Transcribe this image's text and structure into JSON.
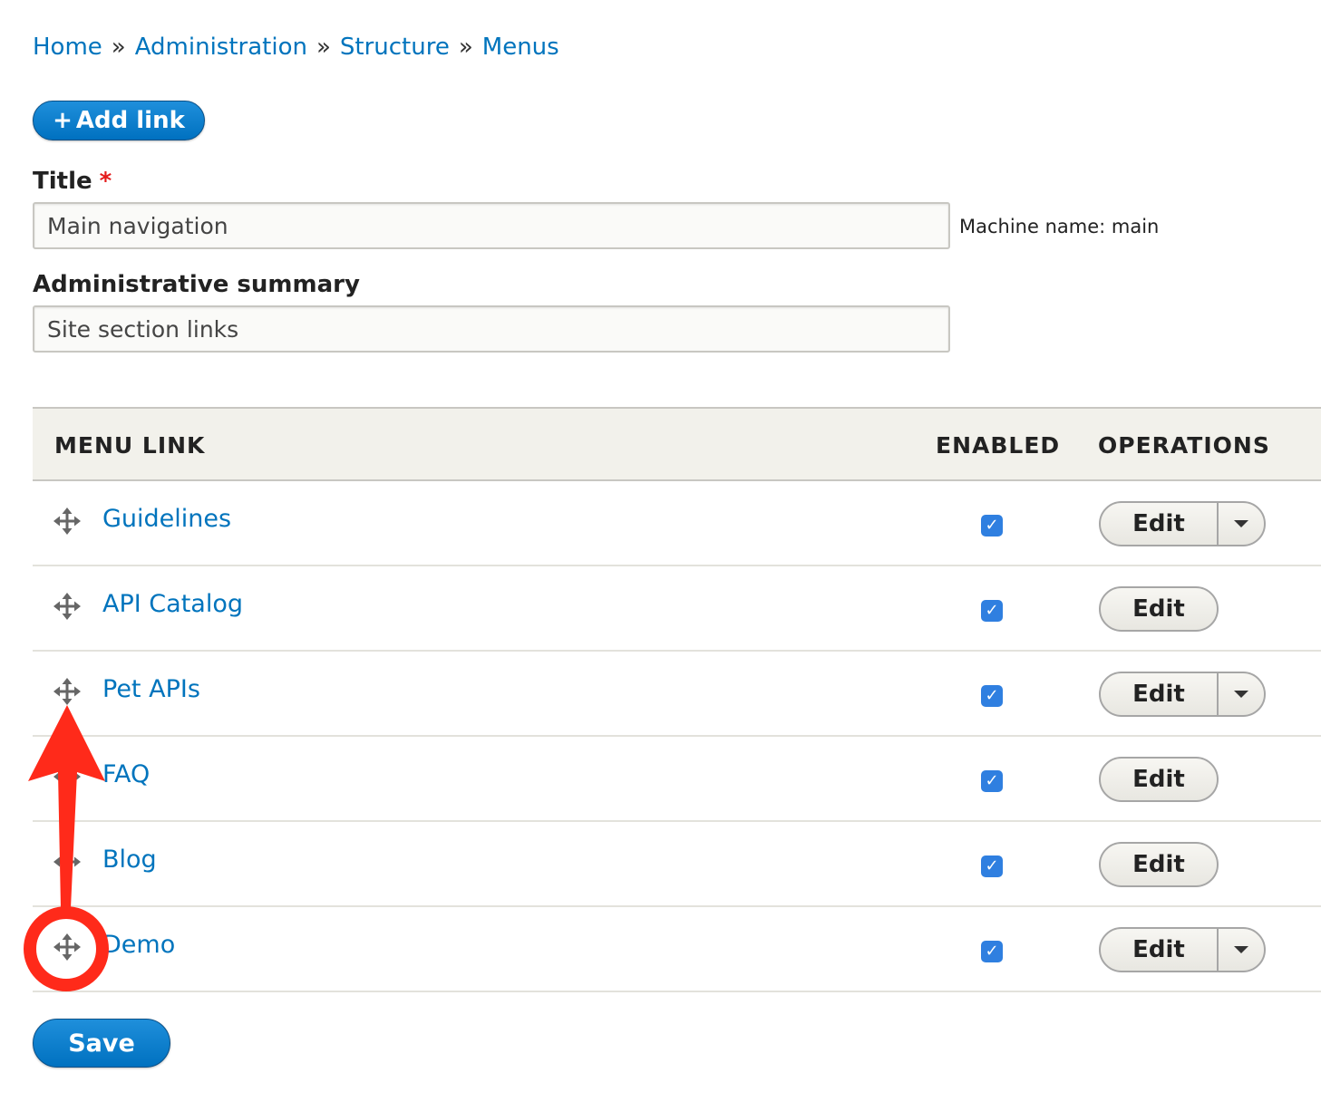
{
  "breadcrumb": {
    "items": [
      "Home",
      "Administration",
      "Structure",
      "Menus"
    ],
    "separator": "»"
  },
  "toolbar": {
    "add_link_label": "Add link",
    "add_link_icon": "+"
  },
  "form": {
    "title_label": "Title",
    "required_marker": "*",
    "title_value": "Main navigation",
    "machine_name": "Machine name: main",
    "summary_label": "Administrative summary",
    "summary_value": "Site section links"
  },
  "table": {
    "headers": {
      "menu_link": "MENU LINK",
      "enabled": "ENABLED",
      "operations": "OPERATIONS"
    },
    "rows": [
      {
        "label": "Guidelines",
        "enabled": true,
        "operation": "Edit",
        "has_dropdown": true
      },
      {
        "label": "API Catalog",
        "enabled": true,
        "operation": "Edit",
        "has_dropdown": false
      },
      {
        "label": "Pet APIs",
        "enabled": true,
        "operation": "Edit",
        "has_dropdown": true
      },
      {
        "label": "FAQ",
        "enabled": true,
        "operation": "Edit",
        "has_dropdown": false
      },
      {
        "label": "Blog",
        "enabled": true,
        "operation": "Edit",
        "has_dropdown": false
      },
      {
        "label": "Demo",
        "enabled": true,
        "operation": "Edit",
        "has_dropdown": true
      }
    ]
  },
  "footer": {
    "save_label": "Save"
  },
  "colors": {
    "link": "#0074bd",
    "primary": "#0071c0",
    "annotation": "#ff2a1a",
    "checkbox": "#2f7fe0"
  },
  "icons": {
    "drag_handle": "move-arrows-icon",
    "checkbox_mark": "✓",
    "annotation": "red-arrow-and-circle"
  }
}
